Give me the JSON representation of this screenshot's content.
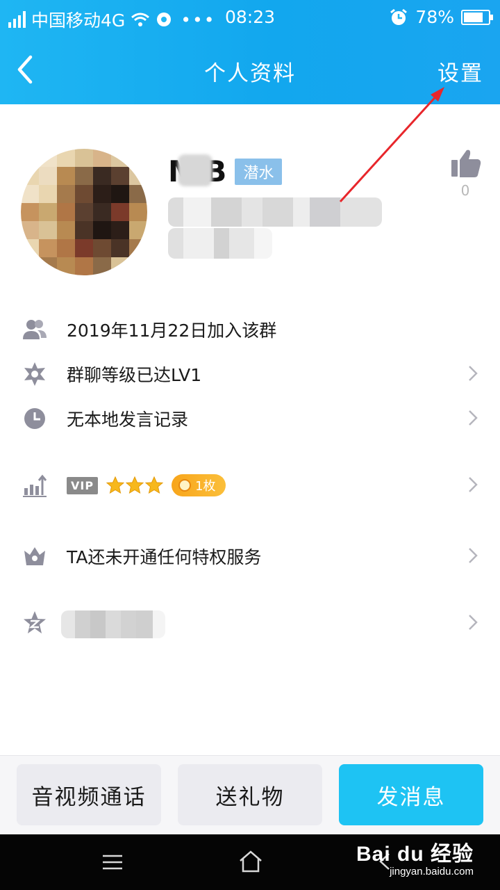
{
  "status_bar": {
    "carrier": "中国移动4G",
    "time": "08:23",
    "battery": "78%",
    "battery_level": 0.78
  },
  "header": {
    "title": "个人资料",
    "settings_label": "设置"
  },
  "profile": {
    "name": "M B",
    "badge": "潜水",
    "like_count": "0"
  },
  "info_rows": {
    "join_date": "2019年11月22日加入该群",
    "level": "群聊等级已达LV1",
    "no_record": "无本地发言记录",
    "vip_label": "VIP",
    "coin_count": "1枚",
    "privilege": "TA还未开通任何特权服务"
  },
  "bottom_buttons": {
    "call": "音视频通话",
    "gift": "送礼物",
    "message": "发消息"
  },
  "watermark": {
    "brand": "Bai du 经验",
    "url": "jingyan.baidu.com"
  },
  "colors": {
    "header": "#12a7ee",
    "primary_button": "#1ec3f3",
    "icon_gray": "#8e8e9c",
    "annotation_arrow": "#e8262b"
  },
  "icons": [
    "back-icon",
    "wifi-icon",
    "alarm-icon",
    "battery-icon",
    "thumb-up-icon",
    "group-members-icon",
    "level-star-icon",
    "clock-icon",
    "chart-icon",
    "crown-icon",
    "qzone-star-icon",
    "chevron-right-icon",
    "menu-icon",
    "home-icon",
    "back-nav-icon"
  ]
}
